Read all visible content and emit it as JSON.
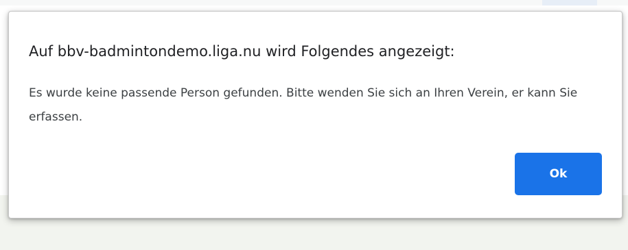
{
  "dialog": {
    "title": "Auf bbv-badmintondemo.liga.nu wird Folgendes angezeigt:",
    "message": "Es wurde keine passende Person gefunden. Bitte wenden Sie sich an Ihren Verein, er kann Sie erfassen.",
    "ok_label": "Ok"
  },
  "colors": {
    "accent": "#1a73e8",
    "page_background_bottom": "#f2f4ef"
  }
}
